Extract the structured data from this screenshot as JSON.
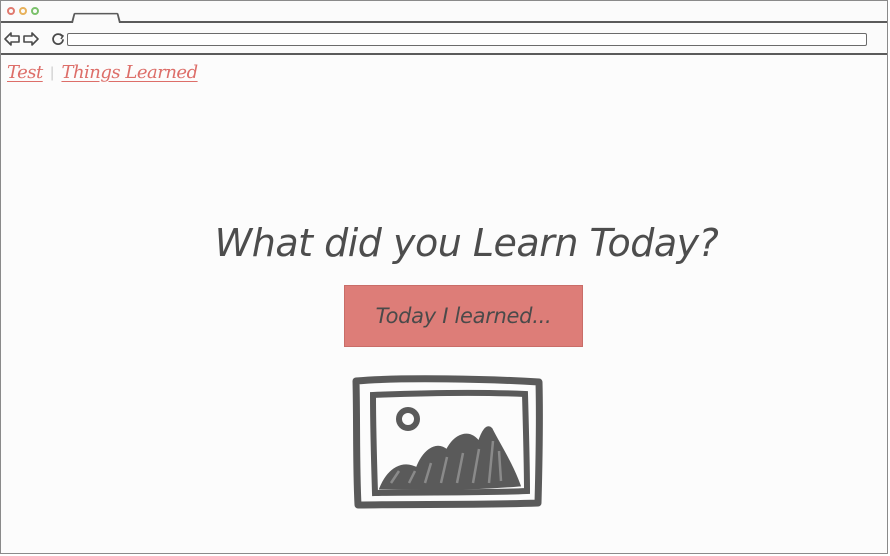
{
  "breadcrumb": {
    "items": [
      {
        "label": "Test"
      },
      {
        "label": "Things Learned"
      }
    ],
    "separator": "|"
  },
  "main": {
    "heading": "What did you Learn Today?",
    "button_label": "Today I learned..."
  },
  "colors": {
    "accent": "#dd7d78",
    "link": "#dd6e69",
    "text": "#4d4d4d",
    "frame": "#5b5b5b"
  },
  "icons": {
    "image_placeholder": "image-icon"
  }
}
